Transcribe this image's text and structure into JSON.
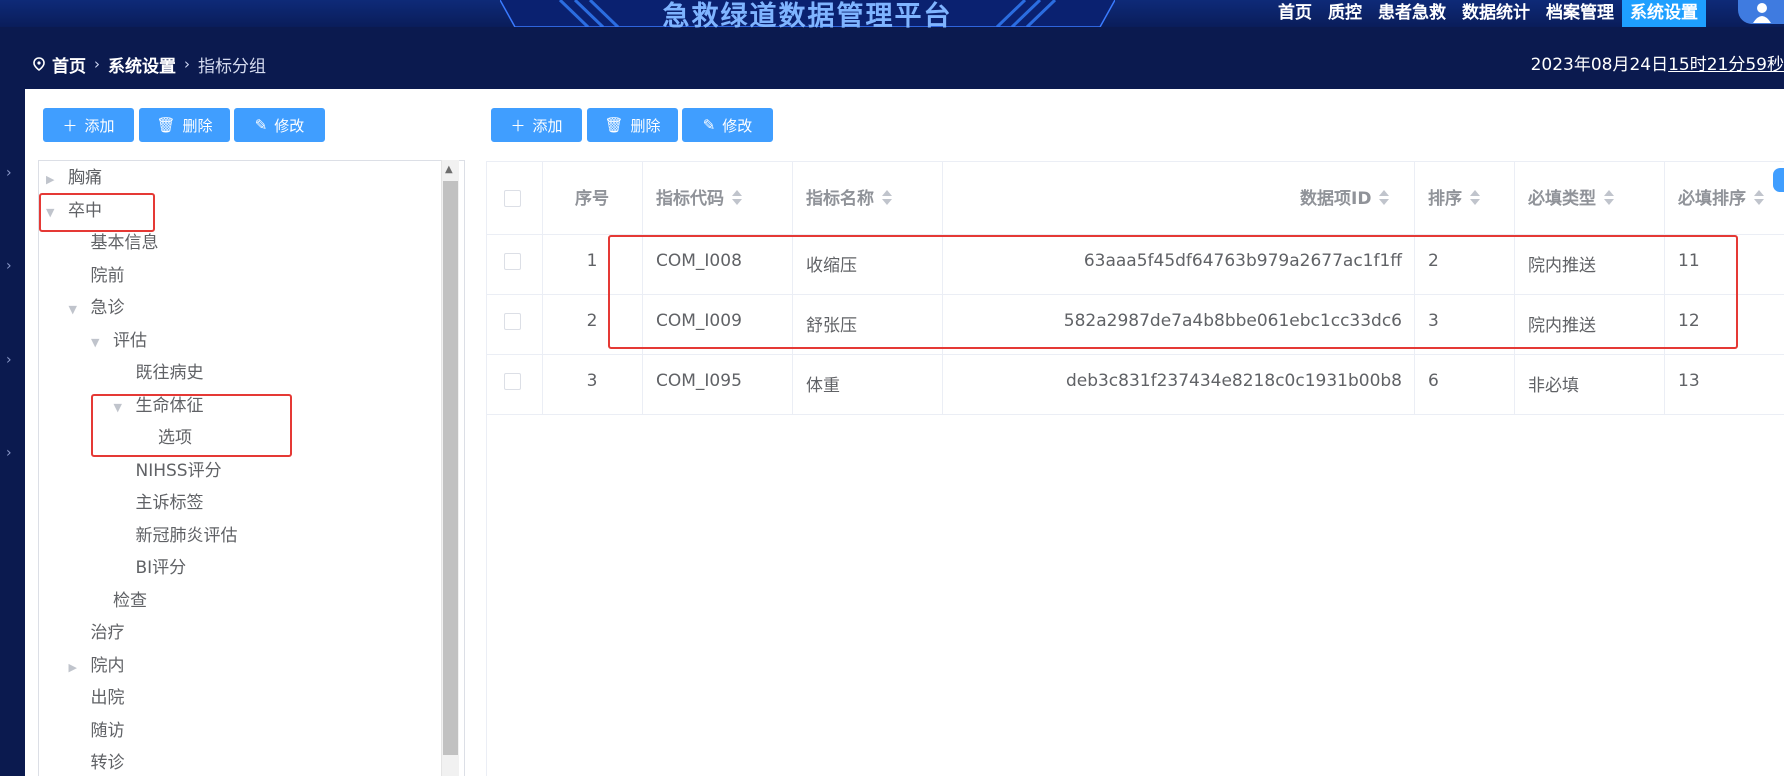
{
  "header": {
    "app_title": "急救绿道数据管理平台",
    "nav": [
      {
        "label": "首页",
        "active": false
      },
      {
        "label": "质控",
        "active": false
      },
      {
        "label": "患者急救",
        "active": false
      },
      {
        "label": "数据统计",
        "active": false
      },
      {
        "label": "档案管理",
        "active": false
      },
      {
        "label": "系统设置",
        "active": true
      }
    ],
    "accent_color": "#1e9fff"
  },
  "breadcrumb": {
    "home": "首页",
    "section": "系统设置",
    "current": "指标分组"
  },
  "datetime": {
    "date": "2023年08月24日",
    "time": "15时21分59秒"
  },
  "left_toolbar": {
    "add": "添加",
    "delete": "删除",
    "edit": "修改"
  },
  "right_toolbar": {
    "add": "添加",
    "delete": "删除",
    "edit": "修改"
  },
  "tree": [
    {
      "label": "胸痛",
      "level": 0,
      "caret": "collapsed"
    },
    {
      "label": "卒中",
      "level": 0,
      "caret": "expanded"
    },
    {
      "label": "基本信息",
      "level": 1,
      "caret": "none"
    },
    {
      "label": "院前",
      "level": 1,
      "caret": "none"
    },
    {
      "label": "急诊",
      "level": 1,
      "caret": "expanded"
    },
    {
      "label": "评估",
      "level": 2,
      "caret": "expanded"
    },
    {
      "label": "既往病史",
      "level": 3,
      "caret": "none"
    },
    {
      "label": "生命体征",
      "level": 3,
      "caret": "expanded"
    },
    {
      "label": "选项",
      "level": 4,
      "caret": "none"
    },
    {
      "label": "NIHSS评分",
      "level": 3,
      "caret": "none"
    },
    {
      "label": "主诉标签",
      "level": 3,
      "caret": "none"
    },
    {
      "label": "新冠肺炎评估",
      "level": 3,
      "caret": "none"
    },
    {
      "label": "BI评分",
      "level": 3,
      "caret": "none"
    },
    {
      "label": "检查",
      "level": 2,
      "caret": "none"
    },
    {
      "label": "治疗",
      "level": 1,
      "caret": "none"
    },
    {
      "label": "院内",
      "level": 1,
      "caret": "collapsed"
    },
    {
      "label": "出院",
      "level": 1,
      "caret": "none"
    },
    {
      "label": "随访",
      "level": 1,
      "caret": "none"
    },
    {
      "label": "转诊",
      "level": 1,
      "caret": "none"
    }
  ],
  "table": {
    "headers": {
      "index": "序号",
      "code": "指标代码",
      "name": "指标名称",
      "data_id": "数据项ID",
      "sort": "排序",
      "required_type": "必填类型",
      "required_sort": "必填排序"
    },
    "rows": [
      {
        "index": "1",
        "code": "COM_I008",
        "name": "收缩压",
        "data_id": "63aaa5f45df64763b979a2677ac1f1ff",
        "sort": "2",
        "required_type": "院内推送",
        "required_sort": "11"
      },
      {
        "index": "2",
        "code": "COM_I009",
        "name": "舒张压",
        "data_id": "582a2987de7a4b8bbe061ebc1cc33dc6",
        "sort": "3",
        "required_type": "院内推送",
        "required_sort": "12"
      },
      {
        "index": "3",
        "code": "COM_I095",
        "name": "体重",
        "data_id": "deb3c831f237434e8218c0c1931b00b8",
        "sort": "6",
        "required_type": "非必填",
        "required_sort": "13"
      }
    ]
  }
}
